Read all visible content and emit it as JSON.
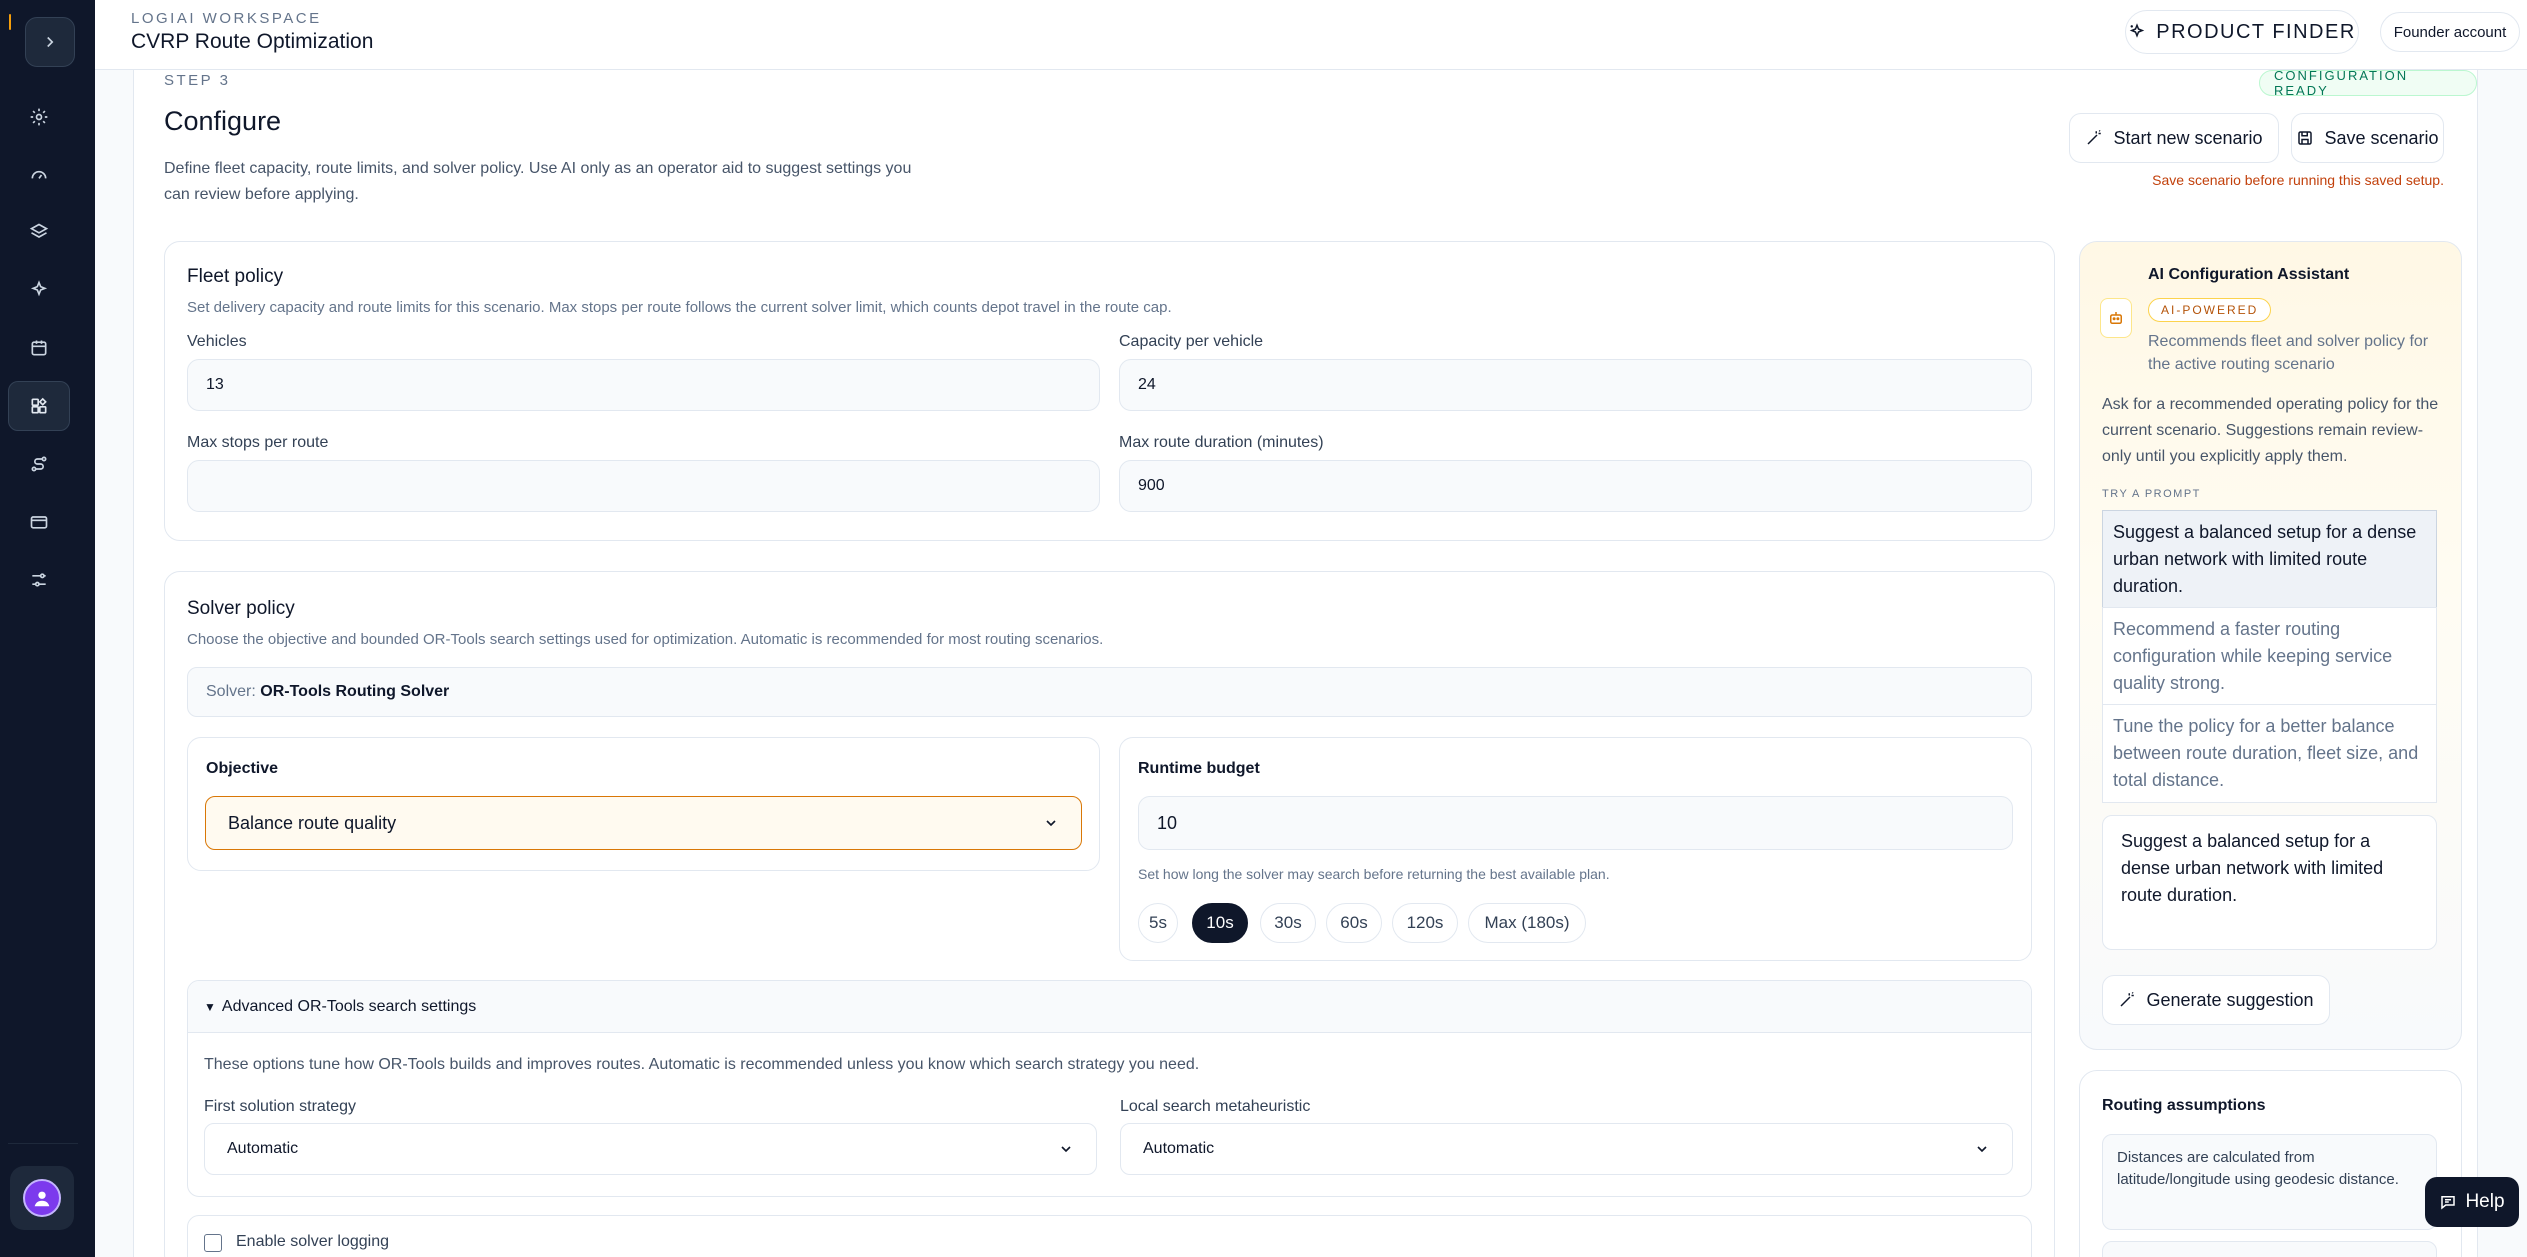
{
  "header": {
    "workspace": "LOGIAI WORKSPACE",
    "title": "CVRP Route Optimization",
    "product_finder": "PRODUCT FINDER",
    "account": "Founder account"
  },
  "page": {
    "step": "STEP 3",
    "status": "CONFIGURATION READY",
    "title": "Configure",
    "description": "Define fleet capacity, route limits, and solver policy. Use AI only as an operator aid to suggest settings you can review before applying.",
    "start_new": "Start new scenario",
    "save": "Save scenario",
    "save_warning": "Save scenario before running this saved setup."
  },
  "fleet": {
    "title": "Fleet policy",
    "subtitle": "Set delivery capacity and route limits for this scenario. Max stops per route follows the current solver limit, which counts depot travel in the route cap.",
    "vehicles_label": "Vehicles",
    "vehicles_value": "13",
    "capacity_label": "Capacity per vehicle",
    "capacity_value": "24",
    "max_stops_label": "Max stops per route",
    "max_stops_value": "",
    "max_duration_label": "Max route duration (minutes)",
    "max_duration_value": "900"
  },
  "solver": {
    "title": "Solver policy",
    "subtitle": "Choose the objective and bounded OR-Tools search settings used for optimization. Automatic is recommended for most routing scenarios.",
    "solver_prefix": "Solver:",
    "solver_name": "OR-Tools Routing Solver",
    "objective_label": "Objective",
    "objective_value": "Balance route quality",
    "runtime_label": "Runtime budget",
    "runtime_value": "10",
    "runtime_help": "Set how long the solver may search before returning the best available plan.",
    "chips": [
      "5s",
      "10s",
      "30s",
      "60s",
      "120s",
      "Max (180s)"
    ],
    "advanced_title": "Advanced OR-Tools search settings",
    "advanced_desc": "These options tune how OR-Tools builds and improves routes. Automatic is recommended unless you know which search strategy you need.",
    "first_solution_label": "First solution strategy",
    "first_solution_value": "Automatic",
    "local_search_label": "Local search metaheuristic",
    "local_search_value": "Automatic",
    "logging_label": "Enable solver logging"
  },
  "ai": {
    "title": "AI Configuration Assistant",
    "badge": "AI-POWERED",
    "subtitle": "Recommends fleet and solver policy for the active routing scenario",
    "intro": "Ask for a recommended operating policy for the current scenario. Suggestions remain review-only until you explicitly apply them.",
    "try_label": "TRY A PROMPT",
    "prompts": [
      "Suggest a balanced setup for a dense urban network with limited route duration.",
      "Recommend a faster routing configuration while keeping service quality strong.",
      "Tune the policy for a better balance between route duration, fleet size, and total distance."
    ],
    "input_value": "Suggest a balanced setup for a dense urban network with limited route duration.",
    "generate": "Generate suggestion"
  },
  "assumptions": {
    "title": "Routing assumptions",
    "item1": "Distances are calculated from latitude/longitude using geodesic distance."
  },
  "help": "Help"
}
